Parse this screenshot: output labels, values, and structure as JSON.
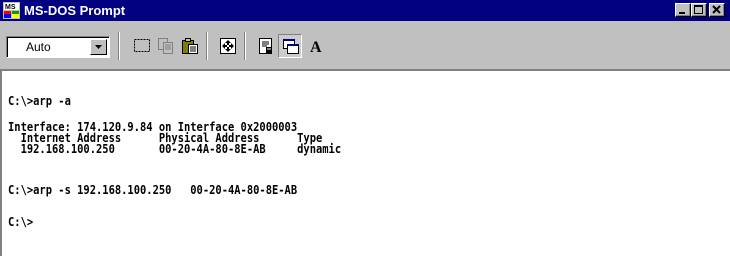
{
  "window": {
    "title": "MS-DOS Prompt"
  },
  "toolbar": {
    "font_size_value": "Auto",
    "buttons": [
      "mark-icon",
      "copy-icon",
      "paste-icon",
      "full-screen-icon",
      "properties-icon",
      "background-icon",
      "font-icon"
    ],
    "font_button_label": "A"
  },
  "console": {
    "lines": [
      "C:\\>arp -a",
      "",
      "Interface: 174.120.9.84 on Interface 0x2000003",
      "  Internet Address      Physical Address      Type",
      "  192.168.100.250       00-20-4A-80-8E-AB     dynamic",
      "",
      "C:\\>arp -s 192.168.100.250   00-20-4A-80-8E-AB",
      "",
      "C:\\>"
    ]
  },
  "colors": {
    "titlebar": "#000080",
    "chrome": "#c0c0c0",
    "console_bg": "#ffffff",
    "console_text": "#000000"
  }
}
